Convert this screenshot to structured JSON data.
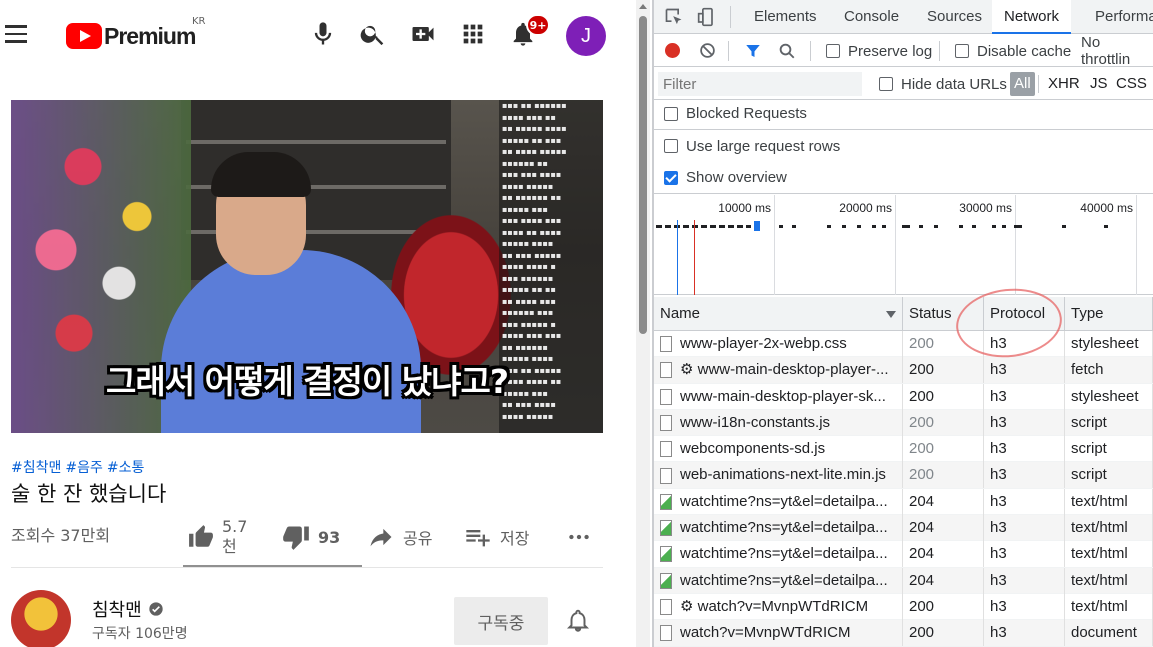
{
  "youtube": {
    "logo_text": "Premium",
    "country_code": "KR",
    "notification_count": "9+",
    "avatar_letter": "J",
    "video": {
      "subtitle": "그래서 어떻게 결정이 났냐고?"
    },
    "hashtags": [
      "#침착맨",
      "#음주",
      "#소통"
    ],
    "title": "술 한 잔 했습니다",
    "views": "조회수 37만회",
    "actions": {
      "like_count": "5.7",
      "like_unit": "천",
      "dislike_count": "93",
      "share_label": "공유",
      "save_label": "저장"
    },
    "channel": {
      "name": "침착맨",
      "subscribers": "구독자 106만명",
      "subscribe_button": "구독중"
    }
  },
  "devtools": {
    "tabs": [
      "Elements",
      "Console",
      "Sources",
      "Network",
      "Performa"
    ],
    "active_tab": "Network",
    "toolbar": {
      "preserve_log": "Preserve log",
      "disable_cache": "Disable cache",
      "throttling": "No throttlin"
    },
    "filter": {
      "placeholder": "Filter",
      "hide_data_urls": "Hide data URLs",
      "type_all": "All",
      "type_xhr": "XHR",
      "type_js": "JS",
      "type_css": "CSS"
    },
    "options": {
      "blocked_requests": "Blocked Requests",
      "large_rows": "Use large request rows",
      "show_overview": "Show overview"
    },
    "overview_labels": [
      "10000 ms",
      "20000 ms",
      "30000 ms",
      "40000 ms"
    ],
    "columns": {
      "name": "Name",
      "status": "Status",
      "protocol": "Protocol",
      "type": "Type"
    },
    "rows": [
      {
        "name": "www-player-2x-webp.css",
        "status": "200",
        "protocol": "h3",
        "type": "stylesheet",
        "icon": "file",
        "dim": true
      },
      {
        "name": "⚙ www-main-desktop-player-...",
        "status": "200",
        "protocol": "h3",
        "type": "fetch",
        "icon": "file",
        "dim": false
      },
      {
        "name": "www-main-desktop-player-sk...",
        "status": "200",
        "protocol": "h3",
        "type": "stylesheet",
        "icon": "file",
        "dim": false
      },
      {
        "name": "www-i18n-constants.js",
        "status": "200",
        "protocol": "h3",
        "type": "script",
        "icon": "file",
        "dim": true
      },
      {
        "name": "webcomponents-sd.js",
        "status": "200",
        "protocol": "h3",
        "type": "script",
        "icon": "file",
        "dim": true
      },
      {
        "name": "web-animations-next-lite.min.js",
        "status": "200",
        "protocol": "h3",
        "type": "script",
        "icon": "file",
        "dim": true
      },
      {
        "name": "watchtime?ns=yt&el=detailpa...",
        "status": "204",
        "protocol": "h3",
        "type": "text/html",
        "icon": "img",
        "dim": false
      },
      {
        "name": "watchtime?ns=yt&el=detailpa...",
        "status": "204",
        "protocol": "h3",
        "type": "text/html",
        "icon": "img",
        "dim": false
      },
      {
        "name": "watchtime?ns=yt&el=detailpa...",
        "status": "204",
        "protocol": "h3",
        "type": "text/html",
        "icon": "img",
        "dim": false
      },
      {
        "name": "watchtime?ns=yt&el=detailpa...",
        "status": "204",
        "protocol": "h3",
        "type": "text/html",
        "icon": "img",
        "dim": false
      },
      {
        "name": "⚙ watch?v=MvnpWTdRICM",
        "status": "200",
        "protocol": "h3",
        "type": "text/html",
        "icon": "file",
        "dim": false
      },
      {
        "name": "watch?v=MvnpWTdRICM",
        "status": "200",
        "protocol": "h3",
        "type": "document",
        "icon": "file",
        "dim": false
      }
    ]
  }
}
